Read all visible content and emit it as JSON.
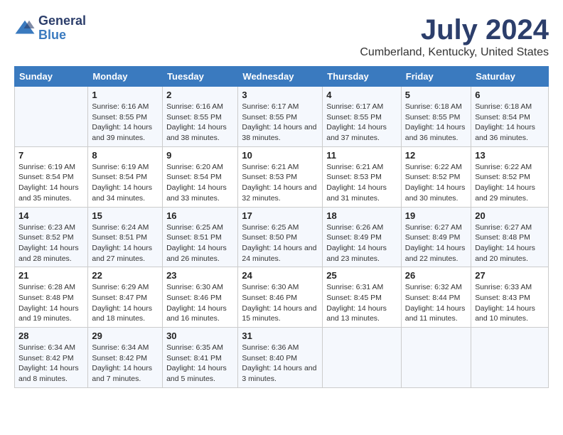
{
  "header": {
    "logo": {
      "general": "General",
      "blue": "Blue"
    },
    "title": "July 2024",
    "subtitle": "Cumberland, Kentucky, United States"
  },
  "days_of_week": [
    "Sunday",
    "Monday",
    "Tuesday",
    "Wednesday",
    "Thursday",
    "Friday",
    "Saturday"
  ],
  "weeks": [
    [
      {
        "num": "",
        "sunrise": "",
        "sunset": "",
        "daylight": ""
      },
      {
        "num": "1",
        "sunrise": "Sunrise: 6:16 AM",
        "sunset": "Sunset: 8:55 PM",
        "daylight": "Daylight: 14 hours and 39 minutes."
      },
      {
        "num": "2",
        "sunrise": "Sunrise: 6:16 AM",
        "sunset": "Sunset: 8:55 PM",
        "daylight": "Daylight: 14 hours and 38 minutes."
      },
      {
        "num": "3",
        "sunrise": "Sunrise: 6:17 AM",
        "sunset": "Sunset: 8:55 PM",
        "daylight": "Daylight: 14 hours and 38 minutes."
      },
      {
        "num": "4",
        "sunrise": "Sunrise: 6:17 AM",
        "sunset": "Sunset: 8:55 PM",
        "daylight": "Daylight: 14 hours and 37 minutes."
      },
      {
        "num": "5",
        "sunrise": "Sunrise: 6:18 AM",
        "sunset": "Sunset: 8:55 PM",
        "daylight": "Daylight: 14 hours and 36 minutes."
      },
      {
        "num": "6",
        "sunrise": "Sunrise: 6:18 AM",
        "sunset": "Sunset: 8:54 PM",
        "daylight": "Daylight: 14 hours and 36 minutes."
      }
    ],
    [
      {
        "num": "7",
        "sunrise": "Sunrise: 6:19 AM",
        "sunset": "Sunset: 8:54 PM",
        "daylight": "Daylight: 14 hours and 35 minutes."
      },
      {
        "num": "8",
        "sunrise": "Sunrise: 6:19 AM",
        "sunset": "Sunset: 8:54 PM",
        "daylight": "Daylight: 14 hours and 34 minutes."
      },
      {
        "num": "9",
        "sunrise": "Sunrise: 6:20 AM",
        "sunset": "Sunset: 8:54 PM",
        "daylight": "Daylight: 14 hours and 33 minutes."
      },
      {
        "num": "10",
        "sunrise": "Sunrise: 6:21 AM",
        "sunset": "Sunset: 8:53 PM",
        "daylight": "Daylight: 14 hours and 32 minutes."
      },
      {
        "num": "11",
        "sunrise": "Sunrise: 6:21 AM",
        "sunset": "Sunset: 8:53 PM",
        "daylight": "Daylight: 14 hours and 31 minutes."
      },
      {
        "num": "12",
        "sunrise": "Sunrise: 6:22 AM",
        "sunset": "Sunset: 8:52 PM",
        "daylight": "Daylight: 14 hours and 30 minutes."
      },
      {
        "num": "13",
        "sunrise": "Sunrise: 6:22 AM",
        "sunset": "Sunset: 8:52 PM",
        "daylight": "Daylight: 14 hours and 29 minutes."
      }
    ],
    [
      {
        "num": "14",
        "sunrise": "Sunrise: 6:23 AM",
        "sunset": "Sunset: 8:52 PM",
        "daylight": "Daylight: 14 hours and 28 minutes."
      },
      {
        "num": "15",
        "sunrise": "Sunrise: 6:24 AM",
        "sunset": "Sunset: 8:51 PM",
        "daylight": "Daylight: 14 hours and 27 minutes."
      },
      {
        "num": "16",
        "sunrise": "Sunrise: 6:25 AM",
        "sunset": "Sunset: 8:51 PM",
        "daylight": "Daylight: 14 hours and 26 minutes."
      },
      {
        "num": "17",
        "sunrise": "Sunrise: 6:25 AM",
        "sunset": "Sunset: 8:50 PM",
        "daylight": "Daylight: 14 hours and 24 minutes."
      },
      {
        "num": "18",
        "sunrise": "Sunrise: 6:26 AM",
        "sunset": "Sunset: 8:49 PM",
        "daylight": "Daylight: 14 hours and 23 minutes."
      },
      {
        "num": "19",
        "sunrise": "Sunrise: 6:27 AM",
        "sunset": "Sunset: 8:49 PM",
        "daylight": "Daylight: 14 hours and 22 minutes."
      },
      {
        "num": "20",
        "sunrise": "Sunrise: 6:27 AM",
        "sunset": "Sunset: 8:48 PM",
        "daylight": "Daylight: 14 hours and 20 minutes."
      }
    ],
    [
      {
        "num": "21",
        "sunrise": "Sunrise: 6:28 AM",
        "sunset": "Sunset: 8:48 PM",
        "daylight": "Daylight: 14 hours and 19 minutes."
      },
      {
        "num": "22",
        "sunrise": "Sunrise: 6:29 AM",
        "sunset": "Sunset: 8:47 PM",
        "daylight": "Daylight: 14 hours and 18 minutes."
      },
      {
        "num": "23",
        "sunrise": "Sunrise: 6:30 AM",
        "sunset": "Sunset: 8:46 PM",
        "daylight": "Daylight: 14 hours and 16 minutes."
      },
      {
        "num": "24",
        "sunrise": "Sunrise: 6:30 AM",
        "sunset": "Sunset: 8:46 PM",
        "daylight": "Daylight: 14 hours and 15 minutes."
      },
      {
        "num": "25",
        "sunrise": "Sunrise: 6:31 AM",
        "sunset": "Sunset: 8:45 PM",
        "daylight": "Daylight: 14 hours and 13 minutes."
      },
      {
        "num": "26",
        "sunrise": "Sunrise: 6:32 AM",
        "sunset": "Sunset: 8:44 PM",
        "daylight": "Daylight: 14 hours and 11 minutes."
      },
      {
        "num": "27",
        "sunrise": "Sunrise: 6:33 AM",
        "sunset": "Sunset: 8:43 PM",
        "daylight": "Daylight: 14 hours and 10 minutes."
      }
    ],
    [
      {
        "num": "28",
        "sunrise": "Sunrise: 6:34 AM",
        "sunset": "Sunset: 8:42 PM",
        "daylight": "Daylight: 14 hours and 8 minutes."
      },
      {
        "num": "29",
        "sunrise": "Sunrise: 6:34 AM",
        "sunset": "Sunset: 8:42 PM",
        "daylight": "Daylight: 14 hours and 7 minutes."
      },
      {
        "num": "30",
        "sunrise": "Sunrise: 6:35 AM",
        "sunset": "Sunset: 8:41 PM",
        "daylight": "Daylight: 14 hours and 5 minutes."
      },
      {
        "num": "31",
        "sunrise": "Sunrise: 6:36 AM",
        "sunset": "Sunset: 8:40 PM",
        "daylight": "Daylight: 14 hours and 3 minutes."
      },
      {
        "num": "",
        "sunrise": "",
        "sunset": "",
        "daylight": ""
      },
      {
        "num": "",
        "sunrise": "",
        "sunset": "",
        "daylight": ""
      },
      {
        "num": "",
        "sunrise": "",
        "sunset": "",
        "daylight": ""
      }
    ]
  ]
}
